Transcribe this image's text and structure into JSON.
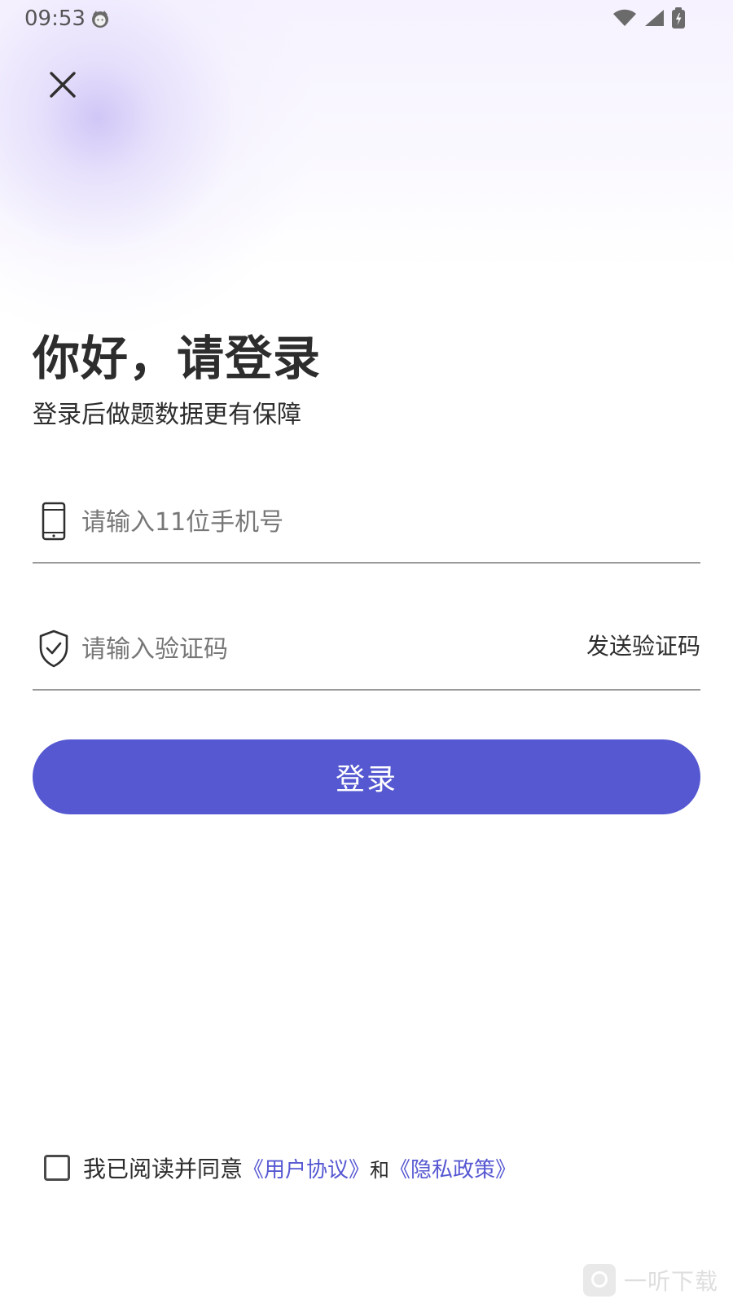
{
  "status_bar": {
    "time": "09:53",
    "icons": [
      "cat-avatar-icon",
      "wifi-icon",
      "signal-icon",
      "battery-charging-icon"
    ]
  },
  "top_actions": {
    "close_icon": "close-icon"
  },
  "hero": {
    "title": "你好，请登录",
    "subtitle": "登录后做题数据更有保障"
  },
  "form": {
    "phone": {
      "icon": "phone-icon",
      "placeholder": "请输入11位手机号",
      "value": ""
    },
    "code": {
      "icon": "shield-check-icon",
      "placeholder": "请输入验证码",
      "value": "",
      "send_label": "发送验证码"
    },
    "submit_label": "登录"
  },
  "agreement": {
    "checked": false,
    "prefix": "我已阅读并同意",
    "user_agreement": "《用户协议》",
    "and": "和",
    "privacy_policy": "《隐私政策》"
  },
  "watermark": {
    "text": "一听下载"
  },
  "colors": {
    "primary": "#5558d0",
    "link": "#5658d2",
    "background_top": "#f6f2ff",
    "text": "#2d2d2d"
  }
}
